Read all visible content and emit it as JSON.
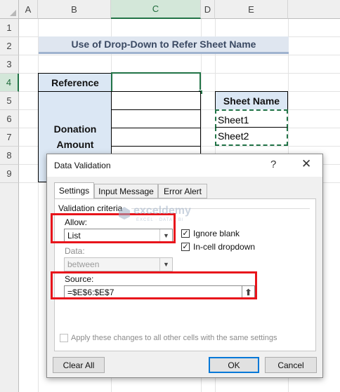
{
  "columns": [
    "A",
    "B",
    "C",
    "D",
    "E"
  ],
  "rows": [
    "1",
    "2",
    "3",
    "4",
    "5",
    "6",
    "7",
    "8",
    "9"
  ],
  "title": "Use of Drop-Down to Refer Sheet Name",
  "table": {
    "reference_label": "Reference",
    "donation_label_line1": "Donation",
    "donation_label_line2": "Amount"
  },
  "sheet_name": {
    "header": "Sheet Name",
    "items": [
      "Sheet1",
      "Sheet2"
    ]
  },
  "dialog": {
    "title": "Data Validation",
    "help": "?",
    "close": "✕",
    "tabs": [
      "Settings",
      "Input Message",
      "Error Alert"
    ],
    "group_label": "Validation criteria",
    "allow_label": "Allow:",
    "allow_value": "List",
    "data_label": "Data:",
    "data_value": "between",
    "ignore_blank_label": "Ignore blank",
    "in_cell_dropdown_label": "In-cell dropdown",
    "source_label": "Source:",
    "source_value": "=$E$6:$E$7",
    "apply_all_label": "Apply these changes to all other cells with the same settings",
    "clear_all": "Clear All",
    "ok": "OK",
    "cancel": "Cancel"
  },
  "watermark": {
    "name": "exceldemy",
    "tagline": "EXCEL · DATA · BI"
  },
  "colors": {
    "accent_green": "#217346",
    "highlight_red": "#e8141b",
    "header_blue": "#dbe7f4",
    "title_blue": "#dfe6f0",
    "focus_blue": "#0078d7"
  }
}
